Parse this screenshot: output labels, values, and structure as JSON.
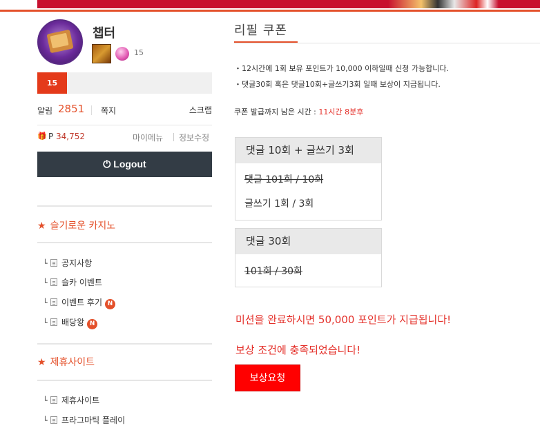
{
  "user": {
    "name": "챕터",
    "gem_count": "15",
    "level": "15",
    "alarm_label": "알림",
    "alarm_count": "2851",
    "memo_label": "쪽지",
    "scrap_label": "스크랩",
    "point_prefix": "P",
    "points": "34,752",
    "mymenu_label": "마이메뉴",
    "edit_label": "정보수정",
    "logout_label": "Logout"
  },
  "sections": [
    {
      "title": "슬기로운 카지노",
      "items": [
        {
          "label": "공지사항",
          "badge": ""
        },
        {
          "label": "슬카 이벤트",
          "badge": ""
        },
        {
          "label": "이벤트 후기",
          "badge": "N"
        },
        {
          "label": "배당왕",
          "badge": "N"
        }
      ]
    },
    {
      "title": "제휴사이트",
      "items": [
        {
          "label": "제휴사이트",
          "badge": ""
        },
        {
          "label": "프라그마틱 플레이",
          "badge": ""
        }
      ]
    }
  ],
  "main": {
    "title": "리필 쿠폰",
    "info1": "・12시간에 1회 보유 포인트가 10,000 이하일때 신청 가능합니다.",
    "info2": "・댓글30회 혹은 댓글10회+글쓰기3회 일때 보상이 지급됩니다.",
    "timer_label": "쿠폰 발급까지 남은 시간 : ",
    "timer_value": "11시간 8분후",
    "box1": {
      "header": "댓글 10회 + 글쓰기 3회",
      "line1": "댓글 101회 / 10회",
      "line2": "글쓰기 1회 / 3회"
    },
    "box2": {
      "header": "댓글 30회",
      "line1": "101회 / 30회"
    },
    "mission_msg": "미션을 완료하시면 50,000 포인트가 지급됩니다!",
    "reward_msg": "보상 조건에 충족되었습니다!",
    "request_button": "보상요청"
  },
  "colors": {
    "accent": "#e4502a",
    "logout_bg": "#333c45",
    "request_bg": "#ff0000"
  }
}
